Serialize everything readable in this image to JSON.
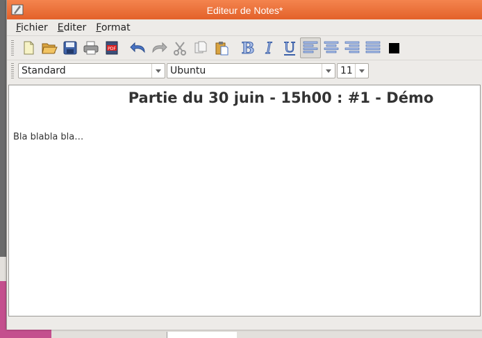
{
  "window": {
    "title": "Editeur de Notes*"
  },
  "menu": [
    {
      "mnemonic": "F",
      "rest": "ichier"
    },
    {
      "mnemonic": "E",
      "rest": "diter"
    },
    {
      "mnemonic": "F",
      "rest": "ormat"
    }
  ],
  "toolbar": {
    "icons": [
      "new-document-icon",
      "open-folder-icon",
      "save-icon",
      "print-icon",
      "export-pdf-icon",
      "undo-icon",
      "redo-icon",
      "cut-icon",
      "copy-icon",
      "paste-icon",
      "bold-icon",
      "italic-icon",
      "underline-icon",
      "align-left-icon",
      "align-center-icon",
      "align-right-icon",
      "justify-icon",
      "text-color-icon"
    ],
    "pdf_label": "PDF",
    "bold_label": "B",
    "italic_label": "I",
    "underline_label": "U",
    "text_color": "#000000",
    "active": "align-left"
  },
  "format": {
    "style": "Standard",
    "font": "Ubuntu",
    "size": "11"
  },
  "document": {
    "heading": "Partie du 30 juin - 15h00 : #1 - Démo",
    "body": "Bla blabla bla…"
  },
  "colors": {
    "titlebar": "#e8693a",
    "accent": "#3a6fb8"
  }
}
